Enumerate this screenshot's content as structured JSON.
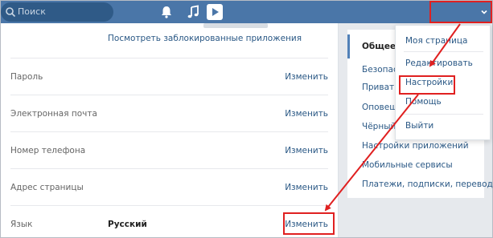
{
  "header": {
    "search_placeholder": "Поиск",
    "icons": [
      "search-icon",
      "bell-icon",
      "music-note-icon",
      "video-play-icon",
      "chevron-down-icon"
    ]
  },
  "main": {
    "blocked_apps_link": "Посмотреть заблокированные приложения",
    "rows": [
      {
        "label": "Пароль",
        "value": "",
        "action": "Изменить"
      },
      {
        "label": "Электронная почта",
        "value": "",
        "action": "Изменить"
      },
      {
        "label": "Номер телефона",
        "value": "",
        "action": "Изменить"
      },
      {
        "label": "Адрес страницы",
        "value": "",
        "action": "Изменить"
      },
      {
        "label": "Язык",
        "value": "Русский",
        "action": "Изменить"
      }
    ]
  },
  "side_menu": {
    "items": [
      "Общее",
      "Безопас",
      "Приватн",
      "Оповеще",
      "Чёрный",
      "Настройки приложений",
      "Мобильные сервисы",
      "Платежи, подписки, переводы"
    ]
  },
  "dropdown": {
    "items": [
      "Моя страница",
      "Редактировать",
      "Настройки",
      "Помощь",
      "Выйти"
    ]
  },
  "colors": {
    "header": "#4a76a8",
    "link": "#2a5885",
    "highlight": "#e02020"
  }
}
